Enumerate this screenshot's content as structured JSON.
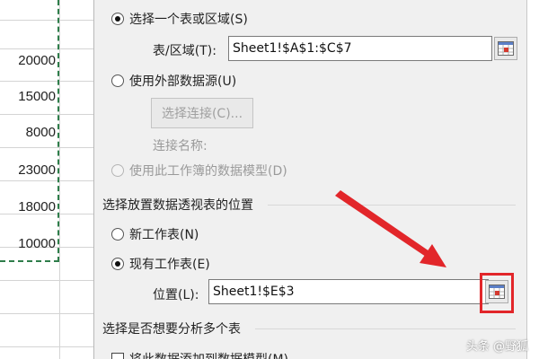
{
  "sheet": {
    "values": [
      "20000",
      "15000",
      "8000",
      "23000",
      "18000",
      "10000"
    ]
  },
  "dialog": {
    "select_table_label": "选择一个表或区域(S)",
    "table_range_label": "表/区域(T):",
    "table_range_value": "Sheet1!$A$1:$C$7",
    "external_source_label": "使用外部数据源(U)",
    "choose_connection_label": "选择连接(C)...",
    "connection_name_label": "连接名称:",
    "data_model_label": "使用此工作簿的数据模型(D)",
    "placement_section_title": "选择放置数据透视表的位置",
    "new_worksheet_label": "新工作表(N)",
    "existing_worksheet_label": "现有工作表(E)",
    "location_label": "位置(L):",
    "location_value": "Sheet1!$E$3",
    "multi_table_section_title": "选择是否想要分析多个表",
    "add_to_model_label": "将此数据添加到数据模型(M)"
  },
  "icons": {
    "range_selector": "range-selector-icon",
    "annotation_arrow": "red-arrow-icon"
  },
  "colors": {
    "annotation_red": "#e2262a",
    "marquee_green": "#2e7d4a"
  },
  "watermark": "头条 @野狐"
}
